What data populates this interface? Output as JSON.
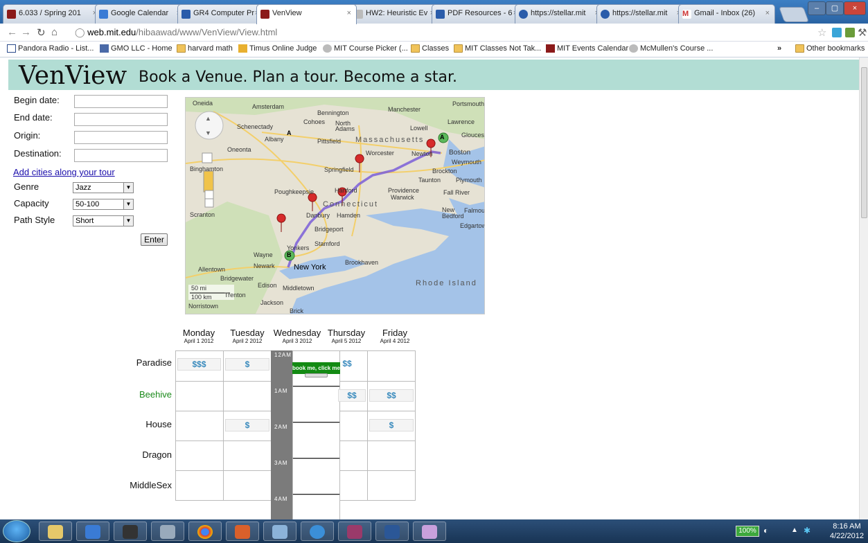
{
  "browser": {
    "tabs": [
      {
        "label": "6.033 / Spring 201",
        "color": "#8b1a1a"
      },
      {
        "label": "Google Calendar",
        "color": "#3a7bd5"
      },
      {
        "label": "GR4 Computer Pr",
        "color": "#2a5caa"
      },
      {
        "label": "VenView",
        "color": "#8b1a1a",
        "active": true
      },
      {
        "label": "HW2: Heuristic Ev",
        "color": "#888888"
      },
      {
        "label": "PDF Resources - 6",
        "color": "#2a5caa"
      },
      {
        "label": "https://stellar.mit",
        "color": "#2a5caa"
      },
      {
        "label": "https://stellar.mit",
        "color": "#2a5caa"
      },
      {
        "label": "Gmail - Inbox (26)",
        "color": "#cc3333"
      }
    ],
    "address_host": "web.mit.edu",
    "address_path": "/hibaawad/www/VenView/View.html",
    "bookmarks": [
      {
        "label": "Pandora Radio - List...",
        "icon": "pandora-icon"
      },
      {
        "label": "GMO LLC - Home",
        "icon": "gmo-icon"
      },
      {
        "label": "harvard math",
        "icon": "folder-icon"
      },
      {
        "label": "Timus Online Judge",
        "icon": "timus-icon"
      },
      {
        "label": "MIT Course Picker (...",
        "icon": "globe-icon"
      },
      {
        "label": "Classes",
        "icon": "folder-icon"
      },
      {
        "label": "MIT Classes Not Tak...",
        "icon": "folder-icon"
      },
      {
        "label": "MIT Events Calendar",
        "icon": "mit-icon"
      },
      {
        "label": "McMullen's Course ...",
        "icon": "globe-icon"
      }
    ],
    "other_bookmarks": "Other bookmarks",
    "overflow": "»"
  },
  "header": {
    "logo": "VenView",
    "tagline": "Book a Venue. Plan a tour. Become a star."
  },
  "form": {
    "begin_label": "Begin date:",
    "end_label": "End date:",
    "origin_label": "Origin:",
    "destination_label": "Destination:",
    "add_cities": "Add cities along your tour",
    "genre_label": "Genre",
    "genre_value": "Jazz",
    "capacity_label": "Capacity",
    "capacity_value": "50-100",
    "path_label": "Path Style",
    "path_value": "Short",
    "enter": "Enter"
  },
  "map": {
    "labels": [
      "Oneida",
      "Amsterdam",
      "Bennington",
      "Manchester",
      "Portsmouth",
      "Schenectady",
      "Cohoes",
      "North Adams",
      "Lowell",
      "Lawrence",
      "Albany",
      "Pittsfield",
      "Massachusetts",
      "Gloucester",
      "Oneonta",
      "Worcester",
      "Newton",
      "Boston",
      "Weymouth",
      "Binghamton",
      "Springfield",
      "Brockton",
      "Taunton",
      "Plymouth",
      "Hartford",
      "Providence",
      "Warwick",
      "Fall River",
      "Poughkeepsie",
      "Connecticut",
      "New Bedford",
      "Falmouth",
      "Scranton",
      "Danbury",
      "Hamden",
      "Edgartown",
      "Bridgeport",
      "Stamford",
      "Yonkers",
      "Wayne",
      "Newark",
      "New York",
      "Brookhaven",
      "Allentown",
      "Bridgewater",
      "Rhode Island",
      "Edison",
      "Middletown",
      "Trenton",
      "Jackson",
      "Norristown",
      "Brick",
      "50 mi",
      "100 km"
    ],
    "marker_a": "A",
    "marker_b": "B"
  },
  "calendar": {
    "days": [
      {
        "name": "Monday",
        "date": "April 1 2012"
      },
      {
        "name": "Tuesday",
        "date": "April 2 2012"
      },
      {
        "name": "Wednesday",
        "date": "April 3 2012"
      },
      {
        "name": "Thursday",
        "date": "April 5 2012"
      },
      {
        "name": "Friday",
        "date": "April 4 2012"
      }
    ],
    "venues": [
      "Paradise",
      "Beehive",
      "House",
      "Dragon",
      "MiddleSex"
    ],
    "highlight_venue_color": "#1a8a1a",
    "prices": {
      "paradise_mon": "$$$",
      "paradise_tue": "$",
      "paradise_thu": "$$",
      "beehive_thu": "$$",
      "beehive_fri": "$$",
      "house_tue": "$",
      "house_fri": "$"
    },
    "times": [
      "12AM",
      "1AM",
      "2AM",
      "3AM",
      "4AM"
    ],
    "booking_popup": "book me, click me"
  },
  "taskbar": {
    "battery": "100%",
    "time": "8:16 AM",
    "date": "4/22/2012"
  }
}
